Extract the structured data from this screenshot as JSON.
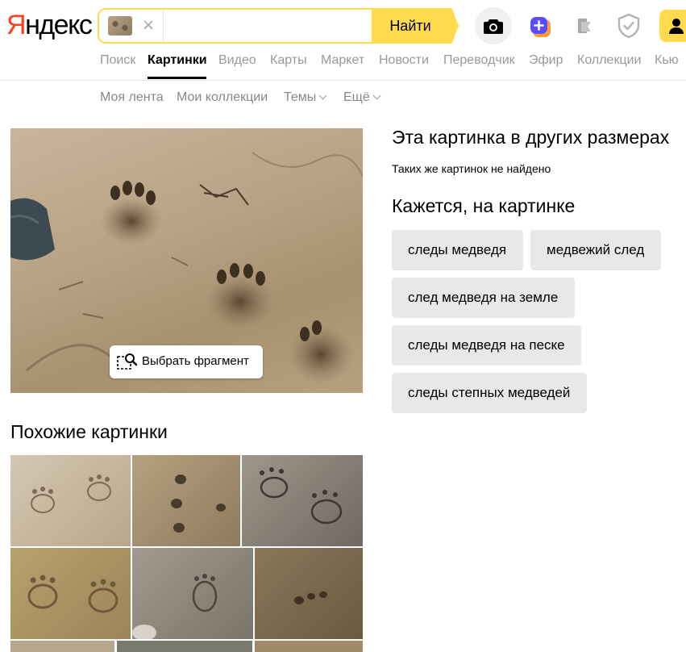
{
  "header": {
    "logo_first_letter": "Я",
    "logo_rest": "ндекс",
    "search": {
      "value": "",
      "placeholder": "",
      "button_label": "Найти"
    }
  },
  "services": {
    "tabs": [
      {
        "label": "Поиск"
      },
      {
        "label": "Картинки",
        "active": true
      },
      {
        "label": "Видео"
      },
      {
        "label": "Карты"
      },
      {
        "label": "Маркет"
      },
      {
        "label": "Новости"
      },
      {
        "label": "Переводчик"
      },
      {
        "label": "Эфир"
      },
      {
        "label": "Коллекции"
      },
      {
        "label": "Кью"
      }
    ]
  },
  "subnav": {
    "items": [
      {
        "label": "Моя лента"
      },
      {
        "label": "Мои коллекции"
      },
      {
        "label": "Темы"
      },
      {
        "label": "Ещё"
      }
    ]
  },
  "main_image": {
    "select_fragment_label": "Выбрать фрагмент"
  },
  "sizes": {
    "title": "Эта картинка в других размерах",
    "note": "Таких же картинок не найдено"
  },
  "tags": {
    "title": "Кажется, на картинке",
    "items": [
      "следы медведя",
      "медвежий след",
      "след медведя на земле",
      "следы медведя на песке",
      "следы степных медведей"
    ]
  },
  "similar": {
    "title": "Похожие картинки"
  },
  "colors": {
    "brand_yellow": "#ffdb4d",
    "logo_red": "#fc3f1d",
    "chip_bg": "#e8e8e8",
    "muted_text": "#999999"
  },
  "icons": [
    "clear-icon",
    "camera-icon",
    "plus-icon",
    "collections-icon",
    "shield-icon",
    "user-icon",
    "fragment-select-icon",
    "chevron-down-icon"
  ]
}
